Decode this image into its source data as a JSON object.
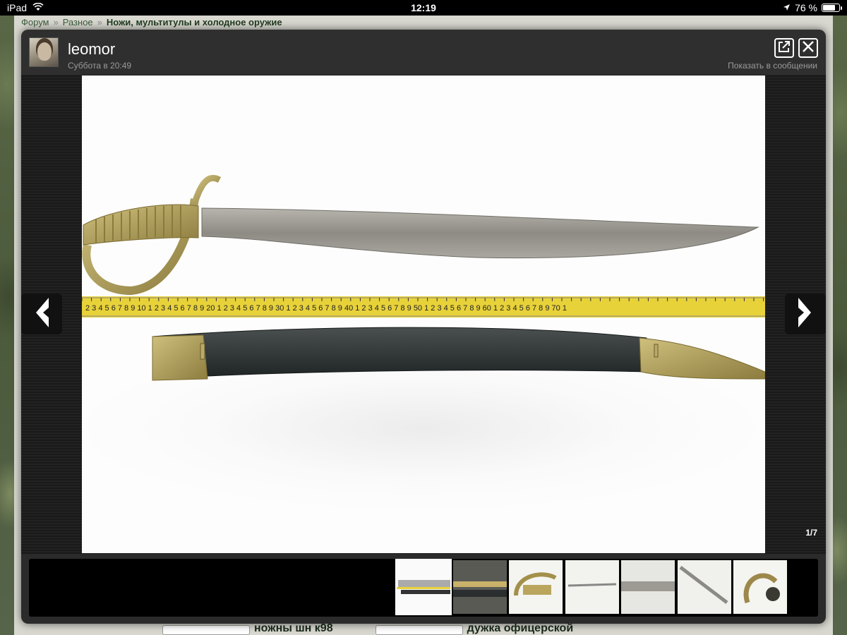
{
  "statusbar": {
    "device": "iPad",
    "time": "12:19",
    "battery_label": "76 %",
    "battery_level": 0.76
  },
  "breadcrumb": {
    "items": [
      "Форум",
      "Разное"
    ],
    "separator": "»",
    "current": "Ножи, мультитулы и холодное оружие"
  },
  "lightbox": {
    "username": "leomor",
    "post_time": "Суббота в 20:49",
    "show_in_post": "Показать в сообщении",
    "counter": "1/7",
    "ruler_text": "2 3 4 5 6 7 8 9 10 1 2 3 4 5 6 7 8 9 20 1 2 3 4 5 6 7 8 9 30 1 2 3 4 5 6 7 8 9 40 1 2 3 4 5 6 7 8 9 50 1 2 3 4 5 6 7 8 9 60 1 2 3 4 5 6 7 8 9 70 1"
  },
  "thumbnails": [
    {
      "id": 1,
      "active": true
    },
    {
      "id": 2,
      "active": false
    },
    {
      "id": 3,
      "active": false
    },
    {
      "id": 4,
      "active": false
    },
    {
      "id": 5,
      "active": false
    },
    {
      "id": 6,
      "active": false
    },
    {
      "id": 7,
      "active": false
    }
  ],
  "page_bottom": {
    "item1": "ножны шн к98",
    "item2": "дужка офицерской"
  },
  "icons": [
    "wifi-icon",
    "location-arrow-icon",
    "battery-icon",
    "external-link-icon",
    "close-icon",
    "arrow-left-icon",
    "arrow-right-icon"
  ],
  "colors": {
    "accent": "#ffffff",
    "overlay": "#2b2b2b",
    "breadcrumb_link": "#3a5a3a"
  }
}
